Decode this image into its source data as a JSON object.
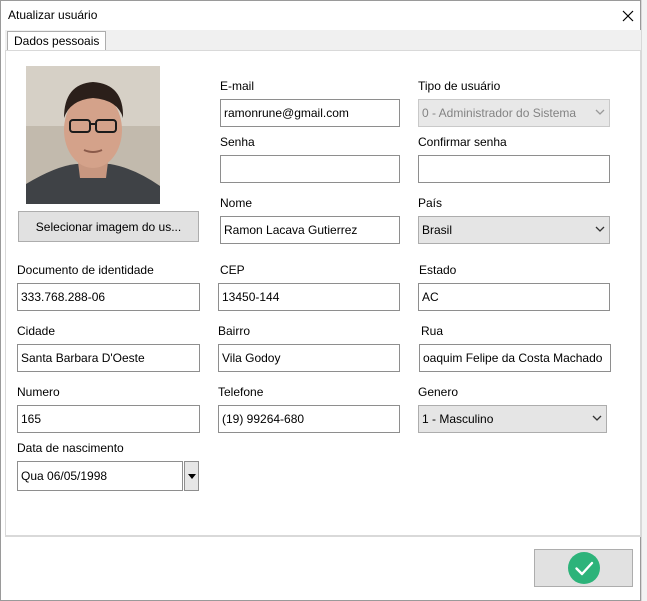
{
  "window": {
    "title": "Atualizar usuário"
  },
  "tabs": [
    {
      "label": "Dados pessoais"
    }
  ],
  "photo": {
    "button_label": "Selecionar imagem do us..."
  },
  "fields": {
    "email": {
      "label": "E-mail",
      "value": "ramonrune@gmail.com"
    },
    "user_type": {
      "label": "Tipo de usuário",
      "value": "0 - Administrador do Sistema"
    },
    "password": {
      "label": "Senha",
      "value": ""
    },
    "confirm_password": {
      "label": "Confirmar senha",
      "value": ""
    },
    "name": {
      "label": "Nome",
      "value": "Ramon Lacava Gutierrez"
    },
    "country": {
      "label": "País",
      "value": "Brasil"
    },
    "id_document": {
      "label": "Documento de identidade",
      "value": "333.768.288-06"
    },
    "cep": {
      "label": "CEP",
      "value": "13450-144"
    },
    "state": {
      "label": "Estado",
      "value": "AC"
    },
    "city": {
      "label": "Cidade",
      "value": "Santa Barbara D'Oeste"
    },
    "district": {
      "label": "Bairro",
      "value": "Vila Godoy"
    },
    "street": {
      "label": "Rua",
      "value": "oaquim Felipe da Costa Machado"
    },
    "number": {
      "label": "Numero",
      "value": "165"
    },
    "phone": {
      "label": "Telefone",
      "value": "(19) 99264-680"
    },
    "gender": {
      "label": "Genero",
      "value": "1 - Masculino"
    },
    "birth_date": {
      "label": "Data de nascimento",
      "value": "Qua 06/05/1998"
    }
  },
  "colors": {
    "confirm_accent": "#2db37a",
    "disabled_text": "#838383",
    "window_border": "#9a9a9a"
  },
  "icons": {
    "close": "close-icon",
    "confirm": "checkmark-circle-icon",
    "dropdown": "chevron-down-icon"
  }
}
